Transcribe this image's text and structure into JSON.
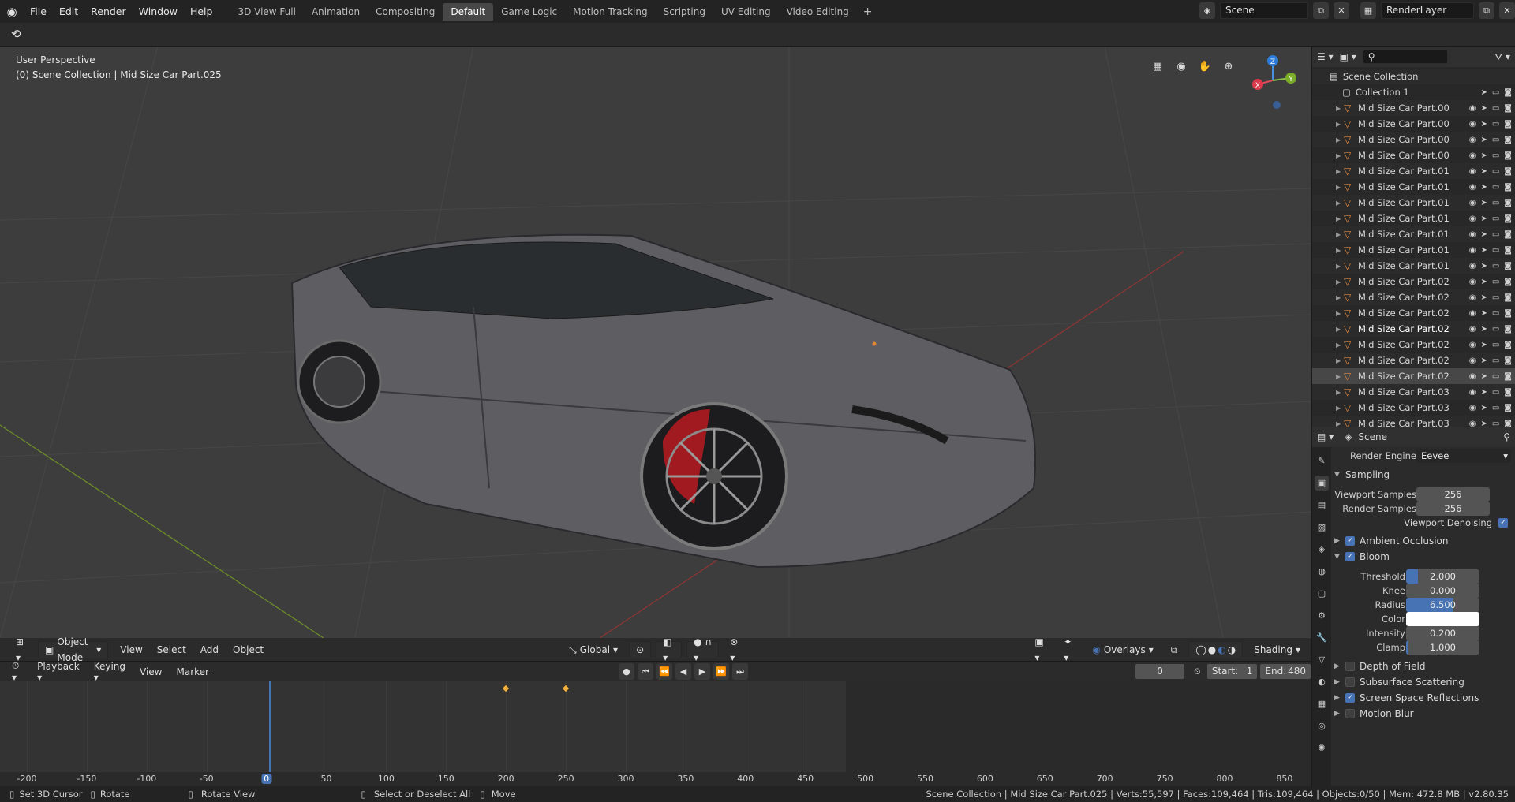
{
  "menubar": {
    "items": [
      "File",
      "Edit",
      "Render",
      "Window",
      "Help"
    ],
    "workspaces": [
      "3D View Full",
      "Animation",
      "Compositing",
      "Default",
      "Game Logic",
      "Motion Tracking",
      "Scripting",
      "UV Editing",
      "Video Editing"
    ],
    "active_workspace": "Default",
    "add_label": "+",
    "scene_name": "Scene",
    "render_layer": "RenderLayer"
  },
  "viewport": {
    "perspective": "User Perspective",
    "collection_label": "(0) Scene Collection | Mid Size Car Part.025",
    "mode": "Object Mode",
    "menus": [
      "View",
      "Select",
      "Add",
      "Object"
    ],
    "orientation": "Global",
    "overlays": "Overlays",
    "shading": "Shading",
    "gizmo_axes": {
      "x": "X",
      "y": "Y",
      "z": "Z"
    }
  },
  "timeline": {
    "menus": [
      "Playback",
      "Keying",
      "View",
      "Marker"
    ],
    "current_frame": "0",
    "start_label": "Start:",
    "start": "1",
    "end_label": "End:",
    "end": "480",
    "ruler_ticks": [
      "-200",
      "-150",
      "-100",
      "-50",
      "0",
      "50",
      "100",
      "150",
      "200",
      "250",
      "300",
      "350",
      "400",
      "450",
      "500",
      "550",
      "600",
      "650",
      "700",
      "750",
      "800",
      "850"
    ],
    "keyframes": [
      "200",
      "250"
    ]
  },
  "outliner": {
    "root": "Scene Collection",
    "collection": "Collection 1",
    "items": [
      "Mid Size Car Part.00",
      "Mid Size Car Part.00",
      "Mid Size Car Part.00",
      "Mid Size Car Part.00",
      "Mid Size Car Part.01",
      "Mid Size Car Part.01",
      "Mid Size Car Part.01",
      "Mid Size Car Part.01",
      "Mid Size Car Part.01",
      "Mid Size Car Part.01",
      "Mid Size Car Part.01",
      "Mid Size Car Part.02",
      "Mid Size Car Part.02",
      "Mid Size Car Part.02",
      "Mid Size Car Part.02",
      "Mid Size Car Part.02",
      "Mid Size Car Part.02",
      "Mid Size Car Part.02",
      "Mid Size Car Part.03",
      "Mid Size Car Part.03",
      "Mid Size Car Part.03"
    ]
  },
  "properties": {
    "context": "Scene",
    "render_engine_label": "Render Engine",
    "render_engine": "Eevee",
    "sampling": "Sampling",
    "viewport_samples_label": "Viewport Samples",
    "viewport_samples": "256",
    "render_samples_label": "Render Samples",
    "render_samples": "256",
    "viewport_denoising": "Viewport Denoising",
    "ambient_occlusion": "Ambient Occlusion",
    "bloom": "Bloom",
    "threshold_label": "Threshold",
    "threshold": "2.000",
    "knee_label": "Knee",
    "knee": "0.000",
    "radius_label": "Radius",
    "radius": "6.500",
    "color_label": "Color",
    "intensity_label": "Intensity",
    "intensity": "0.200",
    "clamp_label": "Clamp",
    "clamp": "1.000",
    "depth_of_field": "Depth of Field",
    "subsurface": "Subsurface Scattering",
    "ssr": "Screen Space Reflections",
    "motion_blur": "Motion Blur"
  },
  "statusbar": {
    "set_cursor": "Set 3D Cursor",
    "rotate": "Rotate",
    "rotate_view": "Rotate View",
    "select": "Select or Deselect All",
    "move": "Move",
    "info": "Scene Collection | Mid Size Car Part.025 | Verts:55,597 | Faces:109,464 | Tris:109,464 | Objects:0/50 | Mem: 472.8 MB | v2.80.35"
  },
  "colors": {
    "accent": "#4772b3",
    "object_icon": "#e5893b",
    "header": "#232323",
    "viewport_bg": "#3d3d3d"
  }
}
